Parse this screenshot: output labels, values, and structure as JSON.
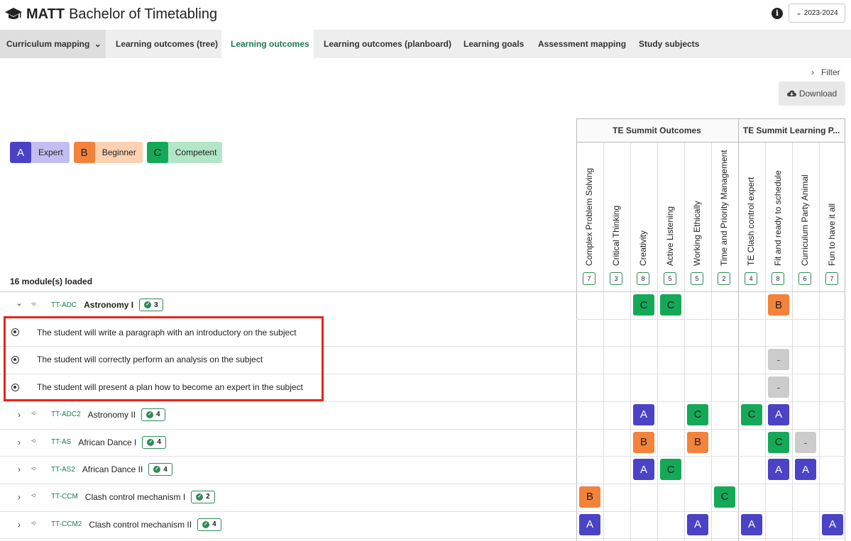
{
  "app": {
    "brand": "MATT",
    "title": "Bachelor of Timetabling",
    "year": "2023-2024"
  },
  "tabs": [
    {
      "label": "Curriculum mapping",
      "active": false
    },
    {
      "label": "Learning outcomes (tree)",
      "active": false
    },
    {
      "label": "Learning outcomes",
      "active": true
    },
    {
      "label": "Learning outcomes (planboard)",
      "active": false
    },
    {
      "label": "Learning goals",
      "active": false
    },
    {
      "label": "Assessment mapping",
      "active": false
    },
    {
      "label": "Study subjects",
      "active": false
    }
  ],
  "toolbar": {
    "filter_label": "Filter",
    "download_label": "Download"
  },
  "legend": [
    {
      "letter": "A",
      "label": "Expert",
      "color": "#4b43c6",
      "bg": "#c2bef0"
    },
    {
      "letter": "B",
      "label": "Beginner",
      "color": "#f3823a",
      "bg": "#fcd1b2"
    },
    {
      "letter": "C",
      "label": "Competent",
      "color": "#14a957",
      "bg": "#b2e6c6"
    }
  ],
  "modules_loaded": "16 module(s) loaded",
  "groups": [
    {
      "label": "TE Summit Outcomes"
    },
    {
      "label": "TE Summit Learning P..."
    }
  ],
  "columns": [
    {
      "title": "Complex Problem Solving",
      "count": "7"
    },
    {
      "title": "Critical Thinking",
      "count": "3"
    },
    {
      "title": "Creativity",
      "count": "8"
    },
    {
      "title": "Active Listening",
      "count": "5"
    },
    {
      "title": "Working Ethically",
      "count": "5"
    },
    {
      "title": "Time and Priority Management",
      "count": "2"
    },
    {
      "title": "TE Clash control expert",
      "count": "4"
    },
    {
      "title": "Fit and ready to schedule",
      "count": "8"
    },
    {
      "title": "Curriculum Party Animal",
      "count": "6"
    },
    {
      "title": "Fun to have it all",
      "count": "7"
    }
  ],
  "rows": [
    {
      "kind": "module",
      "expanded": true,
      "code": "TT-ADC",
      "name": "Astronomy I",
      "count": "3",
      "cells": [
        "",
        "",
        "C",
        "C",
        "",
        "",
        "",
        "B",
        "",
        ""
      ]
    },
    {
      "kind": "outcome",
      "text": "The student will write a paragraph with an introductory on the subject",
      "cells": [
        "",
        "",
        "",
        "",
        "",
        "",
        "",
        "",
        "",
        ""
      ]
    },
    {
      "kind": "outcome",
      "text": "The student will correctly perform an analysis on the subject",
      "cells": [
        "",
        "",
        "",
        "",
        "",
        "",
        "",
        "-",
        "",
        ""
      ]
    },
    {
      "kind": "outcome",
      "text": "The student will present a plan how to become an expert in the subject",
      "cells": [
        "",
        "",
        "",
        "",
        "",
        "",
        "",
        "-",
        "",
        ""
      ]
    },
    {
      "kind": "module",
      "expanded": false,
      "code": "TT-ADC2",
      "name": "Astronomy II",
      "count": "4",
      "cells": [
        "",
        "",
        "A",
        "",
        "C",
        "",
        "C",
        "A",
        "",
        ""
      ]
    },
    {
      "kind": "module",
      "expanded": false,
      "code": "TT-AS",
      "name": "African Dance I",
      "count": "4",
      "cells": [
        "",
        "",
        "B",
        "",
        "B",
        "",
        "",
        "C",
        "-",
        ""
      ]
    },
    {
      "kind": "module",
      "expanded": false,
      "code": "TT-AS2",
      "name": "African Dance II",
      "count": "4",
      "cells": [
        "",
        "",
        "A",
        "C",
        "",
        "",
        "",
        "A",
        "A",
        ""
      ]
    },
    {
      "kind": "module",
      "expanded": false,
      "code": "TT-CCM",
      "name": "Clash control mechanism I",
      "count": "2",
      "cells": [
        "B",
        "",
        "",
        "",
        "",
        "C",
        "",
        "",
        "",
        ""
      ]
    },
    {
      "kind": "module",
      "expanded": false,
      "code": "TT-CCM2",
      "name": "Clash control mechanism II",
      "count": "4",
      "cells": [
        "A",
        "",
        "",
        "",
        "A",
        "",
        "A",
        "",
        "",
        "A"
      ]
    }
  ]
}
